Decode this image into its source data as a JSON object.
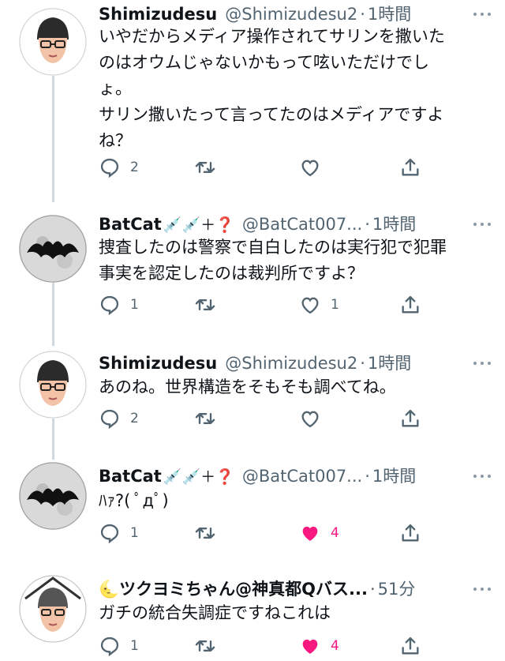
{
  "tweets": [
    {
      "name": "Shimizudesu",
      "name_emoji": "",
      "handle": "@Shimizudesu2",
      "time": "1時間",
      "text_lines": [
        "いやだからメディア操作されてサリンを撒いた",
        "のはオウムじゃないかもって呟いただけでし",
        "ょ。",
        "サリン撒いたって言ってたのはメディアですよ",
        "ね？"
      ],
      "replies": "2",
      "retweets": "",
      "likes": "",
      "liked": false
    },
    {
      "name": "BatCat",
      "name_emoji": "💉💉＋❓",
      "handle": "@BatCat007...",
      "time": "1時間",
      "text_lines": [
        "捜査したのは警察で自白したのは実行犯で犯罪",
        "事実を認定したのは裁判所ですよ？"
      ],
      "replies": "1",
      "retweets": "",
      "likes": "1",
      "liked": false
    },
    {
      "name": "Shimizudesu",
      "name_emoji": "",
      "handle": "@Shimizudesu2",
      "time": "1時間",
      "text_lines": [
        "あのね。世界構造をそもそも調べてね。"
      ],
      "replies": "2",
      "retweets": "",
      "likes": "",
      "liked": false
    },
    {
      "name": "BatCat",
      "name_emoji": "💉💉＋❓",
      "handle": "@BatCat007...",
      "time": "1時間",
      "text_lines": [
        "ﾊｧ?( ﾟдﾟ)"
      ],
      "replies": "1",
      "retweets": "",
      "likes": "4",
      "liked": true
    },
    {
      "name": "🌜ツクヨミちゃん@神真都Qバス...",
      "name_emoji": "",
      "handle": "",
      "time": "51分",
      "text_lines": [
        "ガチの統合失調症ですねこれは"
      ],
      "replies": "1",
      "retweets": "",
      "likes": "4",
      "liked": true
    }
  ],
  "colors": {
    "like_active": "#f91880",
    "secondary_text": "#536471",
    "thread_line": "#cfd9de"
  },
  "icons": [
    "reply-icon",
    "retweet-icon",
    "like-icon",
    "share-icon",
    "more-icon"
  ]
}
